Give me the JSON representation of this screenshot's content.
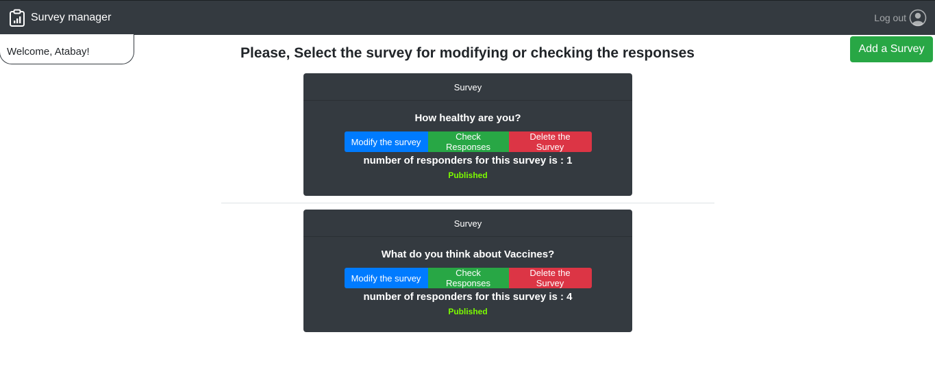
{
  "navbar": {
    "brand": "Survey manager",
    "logout_label": "Log out"
  },
  "welcome": "Welcome, Atabay!",
  "page_heading": "Please, Select the survey for modifying or checking the responses",
  "add_button": "Add a Survey",
  "surveys": [
    {
      "header": "Survey",
      "title": "How healthy are you?",
      "modify_label": "Modify the survey",
      "check_label": "Check Responses",
      "delete_label": "Delete the Survey",
      "responders_text": "number of responders for this survey is : 1",
      "status": "Published"
    },
    {
      "header": "Survey",
      "title": "What do you think about Vaccines?",
      "modify_label": "Modify the survey",
      "check_label": "Check Responses",
      "delete_label": "Delete the Survey",
      "responders_text": "number of responders for this survey is : 4",
      "status": "Published"
    }
  ],
  "colors": {
    "navbar_bg": "#343a40",
    "primary": "#007bff",
    "success": "#28a745",
    "danger": "#dc3545",
    "published": "#7CFC00"
  },
  "icons": {
    "brand": "clipboard-chart-icon",
    "logout": "user-circle-icon"
  }
}
